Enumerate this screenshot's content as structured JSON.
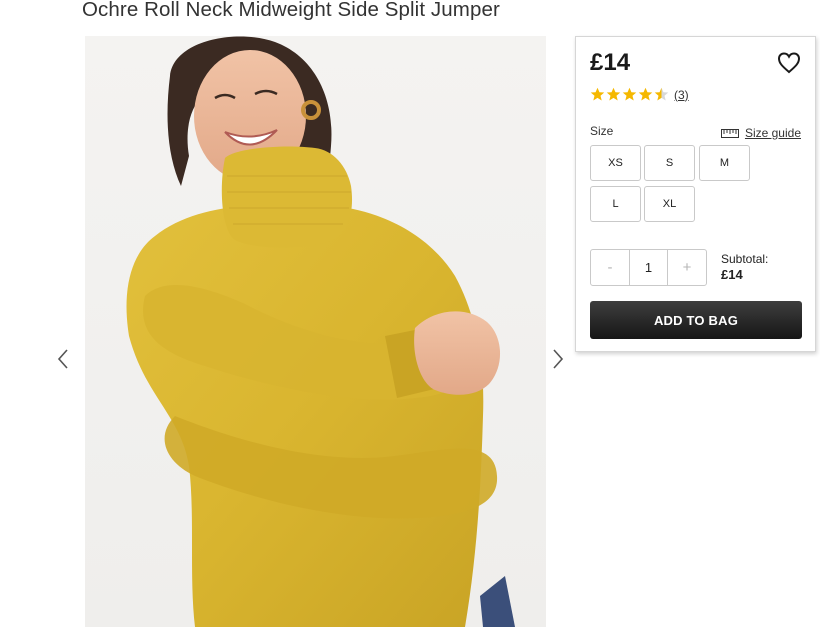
{
  "product": {
    "title": "Ochre Roll Neck Midweight Side Split Jumper",
    "image_alt": "Woman wearing ochre roll neck jumper"
  },
  "gallery": {
    "prev_icon": "chevron-left-icon",
    "next_icon": "chevron-right-icon"
  },
  "buy_panel": {
    "price": "£14",
    "wishlist_icon": "heart-outline-icon",
    "rating": {
      "value": 4.5,
      "max": 5,
      "count_label": "(3)"
    },
    "size_label": "Size",
    "size_guide_label": "Size guide",
    "size_guide_icon": "ruler-icon",
    "sizes": [
      "XS",
      "S",
      "M",
      "L",
      "XL"
    ],
    "quantity": {
      "minus": "-",
      "value": "1",
      "plus": "+"
    },
    "subtotal_label": "Subtotal:",
    "subtotal_value": "£14",
    "add_to_bag_label": "ADD TO BAG",
    "star_color": "#f5b800"
  }
}
